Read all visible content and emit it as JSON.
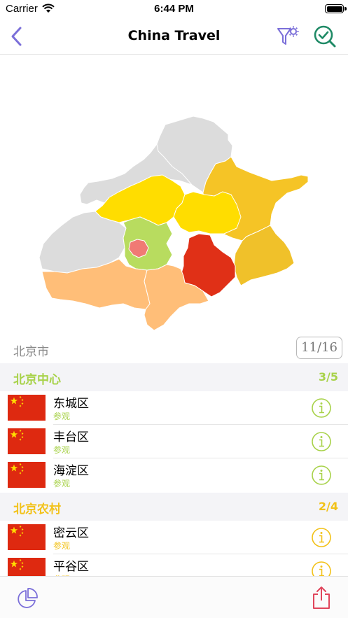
{
  "status": {
    "carrier": "Carrier",
    "time": "6:44 PM"
  },
  "nav": {
    "title": "China Travel",
    "back_icon": "chevron-left-icon",
    "filter_icon": "filter-settings-icon",
    "check_icon": "search-check-icon"
  },
  "colors": {
    "accent_purple": "#7b6fd9",
    "accent_teal": "#1f8a66",
    "section_green": "#a8d24a",
    "section_yellow": "#f2c21a",
    "share_red": "#e0455b",
    "flag_red": "#de2910",
    "flag_star": "#ffde00"
  },
  "map": {
    "districts": [
      {
        "id": "yanqing",
        "color": "#dcdcdc"
      },
      {
        "id": "huairou",
        "color": "#dcdcdc"
      },
      {
        "id": "miyun",
        "color": "#f5c426"
      },
      {
        "id": "pinggu",
        "color": "#f0c12a"
      },
      {
        "id": "changping",
        "color": "#ffdd00"
      },
      {
        "id": "shunyi",
        "color": "#ffdd00"
      },
      {
        "id": "mentougou",
        "color": "#dcdcdc"
      },
      {
        "id": "haidian-chaoyang",
        "color": "#b8dc5f"
      },
      {
        "id": "xicheng-dongcheng",
        "color": "#f07a74"
      },
      {
        "id": "tongzhou",
        "color": "#e03017"
      },
      {
        "id": "fangshan",
        "color": "#ffbe78"
      },
      {
        "id": "daxing",
        "color": "#ffbe78"
      }
    ]
  },
  "region": {
    "name": "北京市",
    "count": "11/16"
  },
  "sections": [
    {
      "title": "北京中心",
      "count": "3/5",
      "color": "#a8d24a",
      "items": [
        {
          "name": "东城区",
          "status": "参观"
        },
        {
          "name": "丰台区",
          "status": "参观"
        },
        {
          "name": "海淀区",
          "status": "参观"
        }
      ]
    },
    {
      "title": "北京农村",
      "count": "2/4",
      "color": "#f2c21a",
      "items": [
        {
          "name": "密云区",
          "status": "参观"
        },
        {
          "name": "平谷区",
          "status": "参观"
        }
      ]
    }
  ],
  "bottom_bar": {
    "left_icon": "pie-chart-icon",
    "right_icon": "share-icon"
  }
}
